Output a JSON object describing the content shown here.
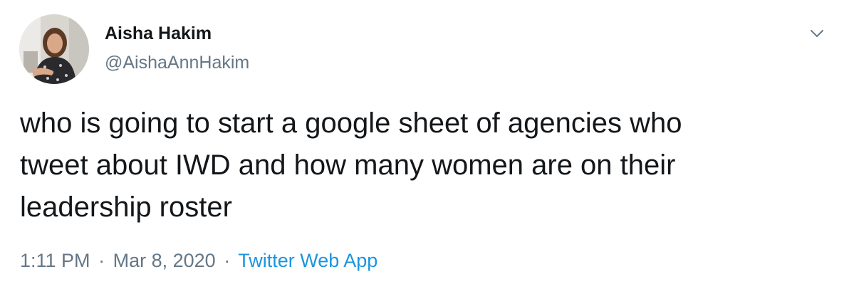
{
  "tweet": {
    "author": {
      "name": "Aisha Hakim",
      "handle": "@AishaAnnHakim"
    },
    "text": "who is going to start a google sheet of agencies who\ntweet about IWD and how many women are on their\nleadership roster",
    "time": "1:11 PM",
    "separator": "·",
    "date": "Mar 8, 2020",
    "source": "Twitter Web App"
  },
  "icons": {
    "menu": "chevron-down-icon"
  },
  "colors": {
    "text": "#14171a",
    "secondary": "#657786",
    "link": "#1b95e0"
  }
}
